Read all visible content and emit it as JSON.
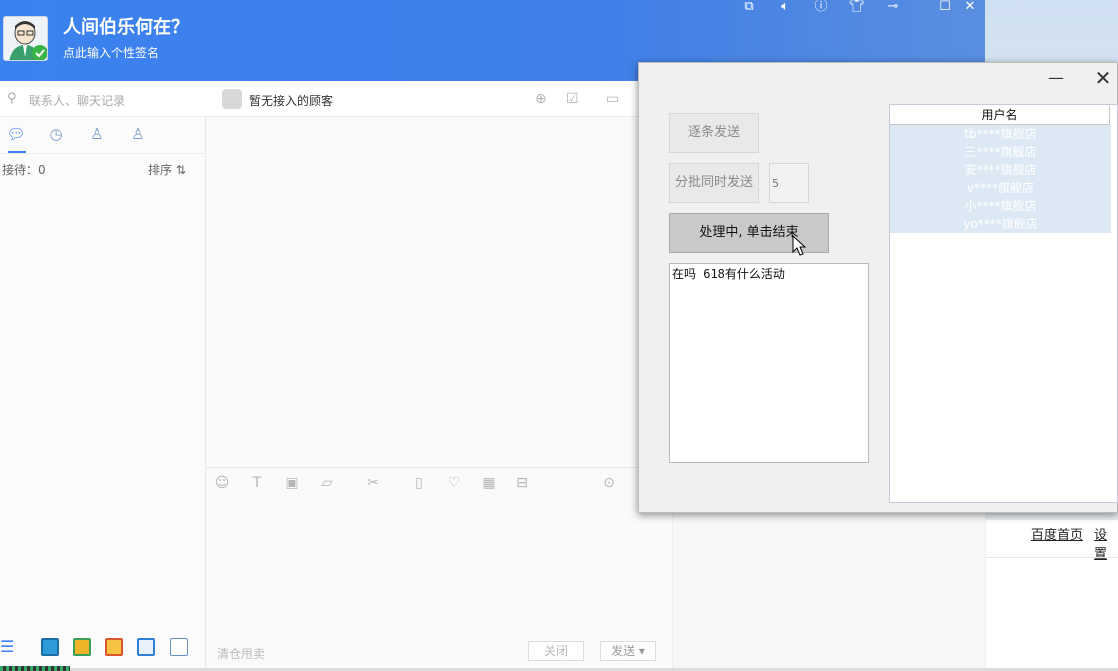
{
  "header": {
    "nickname": "人间伯乐何在？",
    "signature": "点此输入个性签名",
    "top_icons": [
      "window-icon",
      "volume-icon",
      "help-icon",
      "shirt-icon",
      "pin-icon",
      "maximize-icon",
      "close-icon"
    ]
  },
  "left": {
    "search_placeholder": "联系人、聊天记录",
    "receiving": "接待：0",
    "sort": "排序 ⇅"
  },
  "chat": {
    "no_customer": "暂无接入的顾客",
    "clear": "清仓甩卖",
    "close_label": "关闭",
    "send_label": "发送 ▾"
  },
  "links": {
    "baidu_home": "百度首页",
    "settings": "设置"
  },
  "dialog": {
    "btn_one_by_one": "逐条发送",
    "btn_batch": "分批同时发送",
    "batch_size": "5",
    "btn_processing": "处理中, 单击结束",
    "message": "在吗 618有什么活动",
    "list_header": "用户名",
    "list_rows": [
      "tb****旗舰店",
      "三****旗舰店",
      "安****旗舰店",
      "v****旗舰店",
      "小****旗舰店",
      "yo****旗舰店"
    ]
  },
  "colors": {
    "header_blue": "#3b82f0",
    "accent": "#3b82f0"
  }
}
